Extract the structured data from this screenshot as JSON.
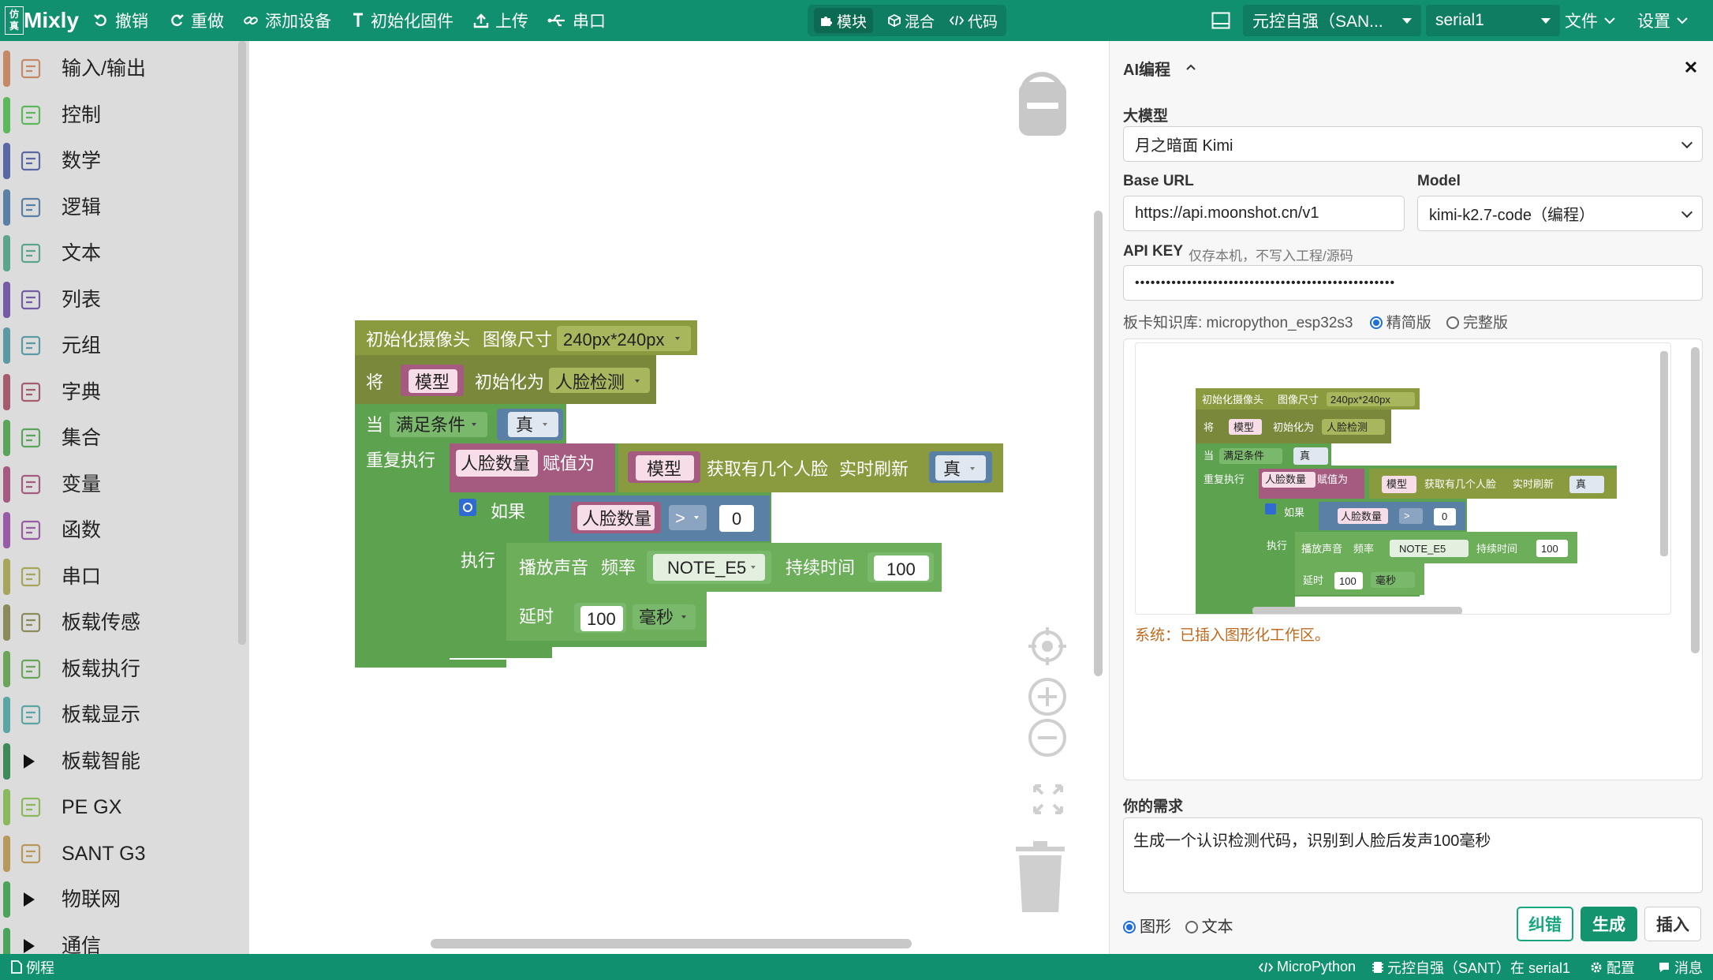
{
  "topbar": {
    "logo_box": "仿真",
    "app_name": "Mixly",
    "undo": "撤销",
    "redo": "重做",
    "add_device": "添加设备",
    "init_firmware": "初始化固件",
    "upload": "上传",
    "serial": "串口",
    "mode_blocks": "模块",
    "mode_mixed": "混合",
    "mode_code": "代码",
    "board_select": "元控自强（SAN...",
    "port_select": "serial1",
    "file_menu": "文件",
    "settings_menu": "设置"
  },
  "sidebar": {
    "categories": [
      {
        "label": "输入/输出",
        "color": "#c58968",
        "icon": "io-icon"
      },
      {
        "label": "控制",
        "color": "#5bb85b",
        "icon": "control-icon"
      },
      {
        "label": "数学",
        "color": "#5b67a5",
        "icon": "math-icon"
      },
      {
        "label": "逻辑",
        "color": "#5b80a5",
        "icon": "logic-icon"
      },
      {
        "label": "文本",
        "color": "#5ba58c",
        "icon": "text-icon"
      },
      {
        "label": "列表",
        "color": "#745ba5",
        "icon": "list-icon"
      },
      {
        "label": "元组",
        "color": "#5b9aa5",
        "icon": "tuple-icon"
      },
      {
        "label": "字典",
        "color": "#a55b6e",
        "icon": "dict-icon"
      },
      {
        "label": "集合",
        "color": "#5ba55b",
        "icon": "set-icon"
      },
      {
        "label": "变量",
        "color": "#a55b80",
        "icon": "variable-icon"
      },
      {
        "label": "函数",
        "color": "#995ba5",
        "icon": "function-icon"
      },
      {
        "label": "串口",
        "color": "#a5a55b",
        "icon": "serial-icon"
      },
      {
        "label": "板载传感",
        "color": "#8a8a5b",
        "icon": "sensor-icon"
      },
      {
        "label": "板载执行",
        "color": "#6aa55b",
        "icon": "actuator-icon"
      },
      {
        "label": "板载显示",
        "color": "#5ba5a5",
        "icon": "display-icon"
      },
      {
        "label": "板载智能",
        "color": "#3d8a5b",
        "icon": "expand-triangle-icon"
      },
      {
        "label": "PE GX",
        "color": "#8ab85b",
        "icon": "pe-gx-icon"
      },
      {
        "label": "SANT G3",
        "color": "#b8985b",
        "icon": "sant-g3-icon"
      },
      {
        "label": "物联网",
        "color": "#4aa55b",
        "icon": "expand-triangle-icon"
      },
      {
        "label": "通信",
        "color": "#4aa55b",
        "icon": "expand-triangle-icon"
      }
    ]
  },
  "workspace": {
    "blocks": {
      "init_camera": "初始化摄像头",
      "image_size": "图像尺寸",
      "image_size_value": "240px*240px",
      "set": "将",
      "model_var": "模型",
      "init_as": "初始化为",
      "face_detect": "人脸检测",
      "when": "当",
      "condition": "满足条件",
      "true_val": "真",
      "repeat": "重复执行",
      "face_count": "人脸数量",
      "assign": "赋值为",
      "get_faces": "获取有几个人脸",
      "realtime": "实时刷新",
      "if": "如果",
      "op": ">",
      "zero": "0",
      "do": "执行",
      "play_sound": "播放声音",
      "freq": "频率",
      "note": "NOTE_E5",
      "duration": "持续时间",
      "dur_value": "100",
      "delay": "延时",
      "delay_value": "100",
      "ms": "毫秒"
    }
  },
  "ai_panel": {
    "title": "AI编程",
    "model_label": "大模型",
    "model_value": "月之暗面 Kimi",
    "base_url_label": "Base URL",
    "base_url_value": "https://api.moonshot.cn/v1",
    "model2_label": "Model",
    "model2_value": "kimi-k2.7-code（编程）",
    "api_key_label": "API KEY",
    "api_key_hint": "仅存本机，不写入工程/源码",
    "api_key_value": "••••••••••••••••••••••••••••••••••••••••••••••••••",
    "kb_label": "板卡知识库: micropython_esp32s3",
    "kb_opt1": "精简版",
    "kb_opt2": "完整版",
    "system_msg": "系统：已插入图形化工作区。",
    "need_label": "你的需求",
    "need_value": "生成一个认识检测代码，识别到人脸后发声100毫秒",
    "out_opt1": "图形",
    "out_opt2": "文本",
    "btn_fix": "纠错",
    "btn_generate": "生成",
    "btn_insert": "插入"
  },
  "statusbar": {
    "examples": "例程",
    "language": "MicroPython",
    "board_status": "元控自强（SANT）在 serial1",
    "config": "配置",
    "messages": "消息"
  },
  "colors": {
    "brand": "#11906f",
    "block_camera": "#8a9a3e",
    "block_control": "#5ca24f",
    "block_variable": "#a55b80",
    "block_logic": "#5b80a5",
    "block_green": "#6cae59"
  }
}
